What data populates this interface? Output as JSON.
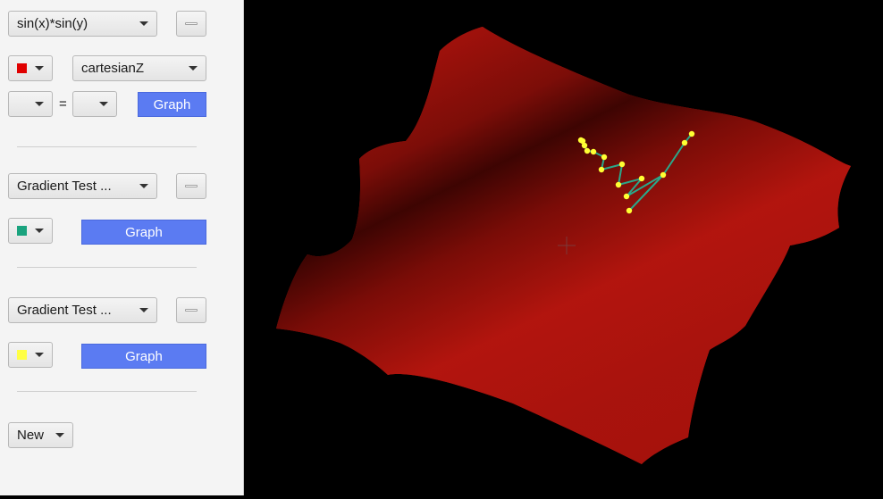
{
  "panel": {
    "equation": {
      "function_label": "sin(x)*sin(y)",
      "color": "#e00000",
      "coord_system": "cartesianZ",
      "lhs": "",
      "equals": "=",
      "rhs": "",
      "graph_label": "Graph"
    },
    "gradient1": {
      "label": "Gradient Test ...",
      "color": "#1aa37e",
      "graph_label": "Graph"
    },
    "gradient2": {
      "label": "Gradient Test ...",
      "color": "#ffff44",
      "graph_label": "Graph"
    },
    "new_label": "New"
  },
  "colors": {
    "surface": "#a30f0b",
    "path_line": "#2aa88a",
    "path_point": "#ffff33",
    "button_accent": "#5b7bf2"
  }
}
